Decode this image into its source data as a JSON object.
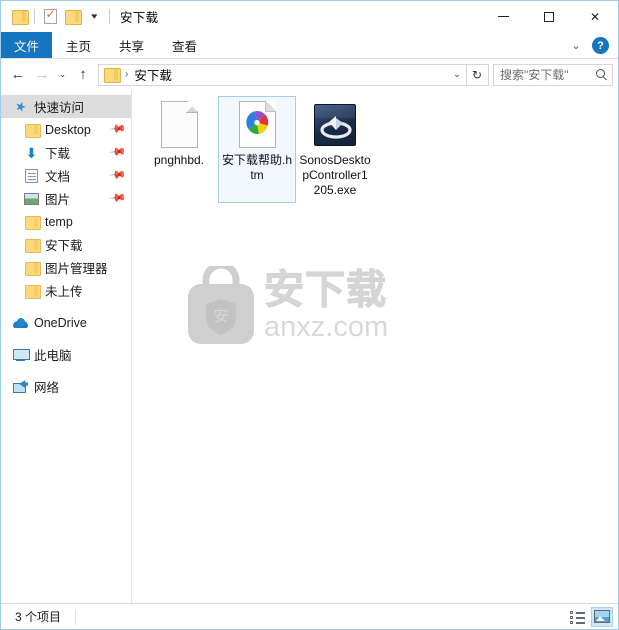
{
  "window": {
    "title": "安下载",
    "quick_access": [
      {
        "name": "folder-icon",
        "label": ""
      },
      {
        "name": "properties-icon",
        "label": ""
      },
      {
        "name": "folder-icon-2",
        "label": ""
      },
      {
        "name": "customize-dropdown",
        "label": "▾"
      }
    ],
    "controls": {
      "minimize": "–",
      "maximize": "□",
      "close": "✕"
    }
  },
  "ribbon": {
    "tabs": [
      {
        "label": "文件",
        "active": true
      },
      {
        "label": "主页",
        "active": false
      },
      {
        "label": "共享",
        "active": false
      },
      {
        "label": "查看",
        "active": false
      }
    ],
    "expand_label": "⌄",
    "help_label": "?"
  },
  "address_bar": {
    "back": "←",
    "forward": "→",
    "recent": "⌄",
    "up": "↑",
    "breadcrumb": [
      "安下载"
    ],
    "separator": "›",
    "dropdown": "⌄",
    "refresh": "↻"
  },
  "search": {
    "placeholder": "搜索\"安下载\""
  },
  "sidebar": {
    "items": [
      {
        "label": "快速访问",
        "icon": "star-icon",
        "selected": true,
        "pinned": false,
        "indent": 0
      },
      {
        "label": "Desktop",
        "icon": "folder-icon",
        "selected": false,
        "pinned": true,
        "indent": 1
      },
      {
        "label": "下载",
        "icon": "download-icon",
        "selected": false,
        "pinned": true,
        "indent": 1
      },
      {
        "label": "文档",
        "icon": "documents-icon",
        "selected": false,
        "pinned": true,
        "indent": 1
      },
      {
        "label": "图片",
        "icon": "pictures-icon",
        "selected": false,
        "pinned": true,
        "indent": 1
      },
      {
        "label": "temp",
        "icon": "folder-icon",
        "selected": false,
        "pinned": false,
        "indent": 1
      },
      {
        "label": "安下载",
        "icon": "folder-icon",
        "selected": false,
        "pinned": false,
        "indent": 1
      },
      {
        "label": "图片管理器",
        "icon": "folder-icon",
        "selected": false,
        "pinned": false,
        "indent": 1
      },
      {
        "label": "未上传",
        "icon": "folder-icon",
        "selected": false,
        "pinned": false,
        "indent": 1
      },
      {
        "label": "OneDrive",
        "icon": "cloud-icon",
        "selected": false,
        "pinned": false,
        "indent": 0
      },
      {
        "label": "此电脑",
        "icon": "this-pc-icon",
        "selected": false,
        "pinned": false,
        "indent": 0
      },
      {
        "label": "网络",
        "icon": "network-icon",
        "selected": false,
        "pinned": false,
        "indent": 0
      }
    ],
    "pin_glyph": "📌"
  },
  "files": [
    {
      "name": "pnghhbd.",
      "icon": "blank-document-icon",
      "selected": false
    },
    {
      "name": "安下载帮助.htm",
      "icon": "html-document-icon",
      "selected": true
    },
    {
      "name": "SonosDesktopController1205.exe",
      "icon": "sonos-application-icon",
      "selected": false
    }
  ],
  "watermark": {
    "logo_char": "安",
    "cn_text": "安下载",
    "en_text": "anxz.com"
  },
  "status_bar": {
    "item_count": "3 个项目",
    "views": [
      {
        "name": "details-view",
        "active": false
      },
      {
        "name": "large-icons-view",
        "active": true
      }
    ]
  },
  "colors": {
    "accent": "#1675c0",
    "selection": "#f2f8fd",
    "selection_border": "#9fd0ef",
    "folder_yellow": "#fcd97a",
    "window_border": "#9ecbe8"
  }
}
